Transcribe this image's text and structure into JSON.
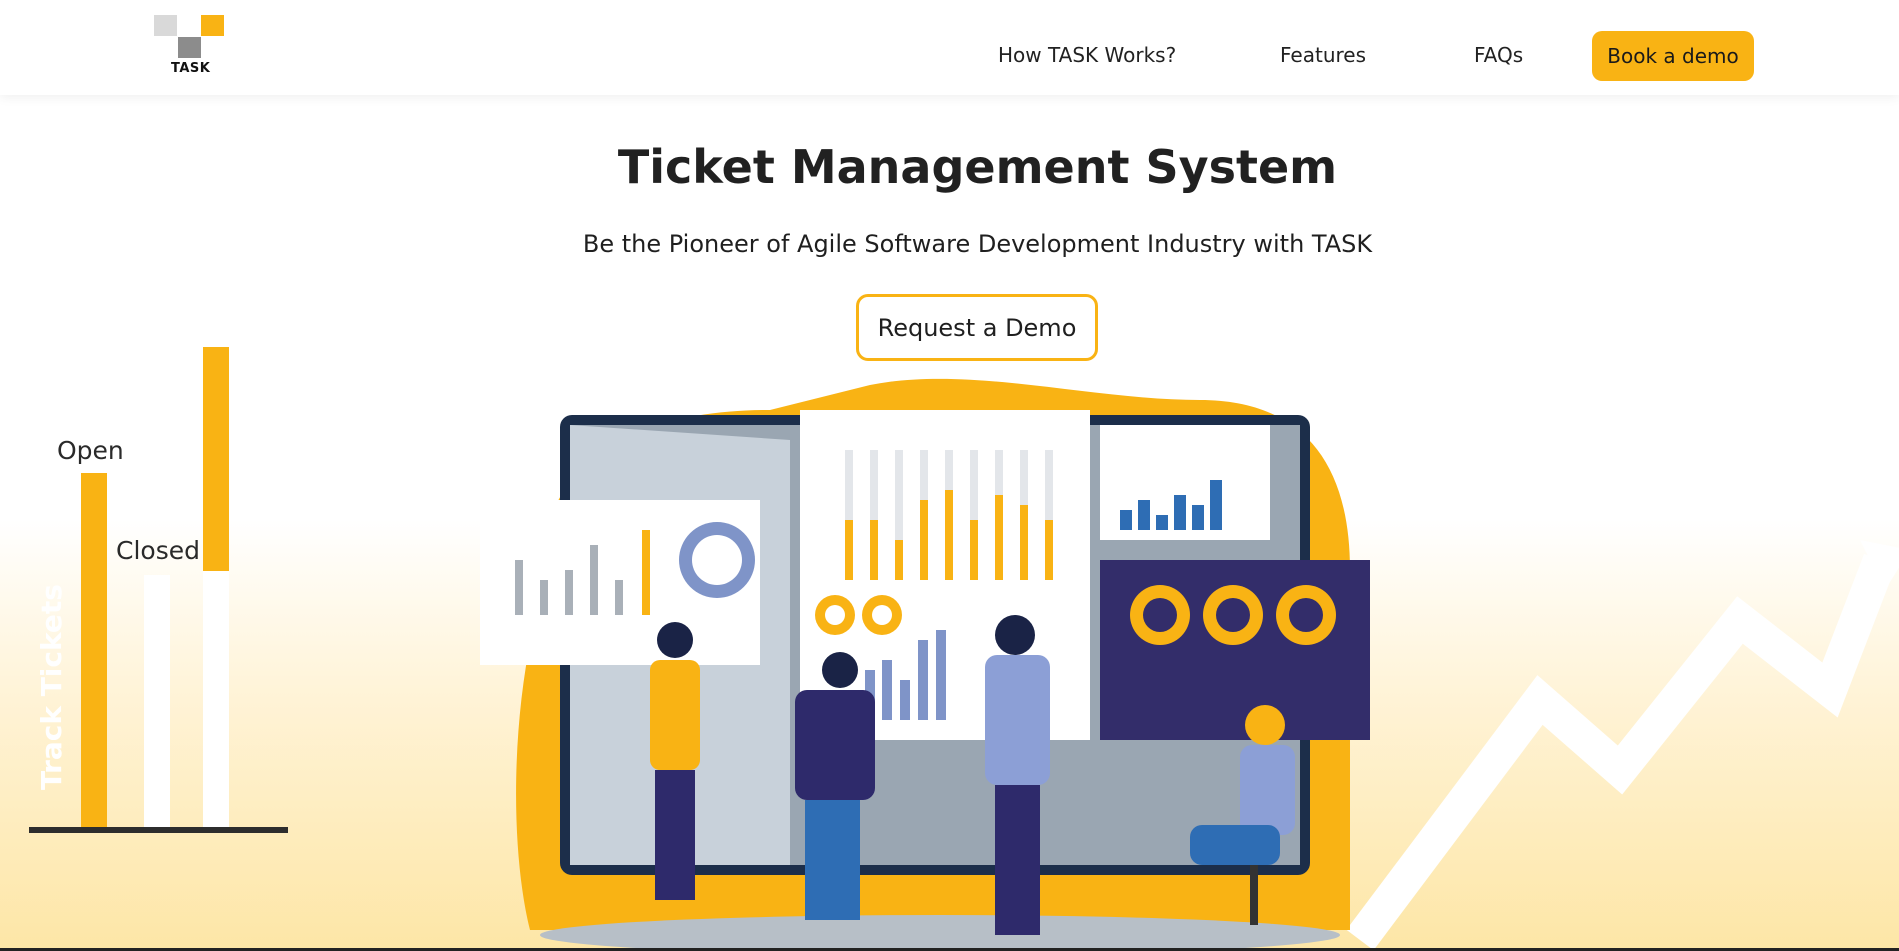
{
  "brand": {
    "logo_text": "TASK"
  },
  "nav": {
    "items": [
      "How TASK Works?",
      "Features",
      "FAQs"
    ],
    "cta": "Book a demo"
  },
  "hero": {
    "title": "Ticket Management System",
    "subtitle": "Be the Pioneer of Agile Software Development Industry with TASK",
    "button": "Request a Demo"
  },
  "side_chart": {
    "open_label": "Open",
    "closed_label": "Closed",
    "axis_label": "Track Tickets"
  },
  "colors": {
    "accent": "#f9b314",
    "dark_navy": "#2e2a6b",
    "text": "#1f1f1f"
  }
}
